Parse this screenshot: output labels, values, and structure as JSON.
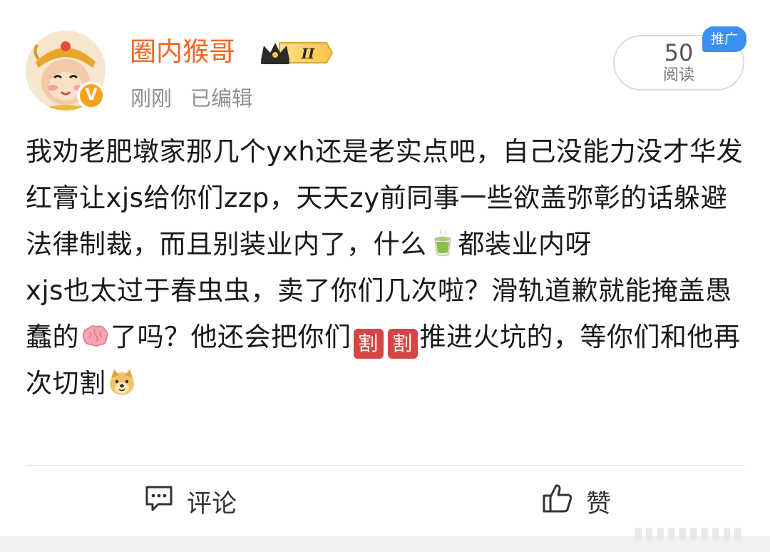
{
  "post": {
    "author": {
      "name": "圈内猴哥",
      "verified_mark": "V",
      "level_badge": "II",
      "avatar_icon": "monkey-king-avatar"
    },
    "meta": {
      "time": "刚刚",
      "edited": "已编辑"
    },
    "stats": {
      "read_count": "50",
      "read_label": "阅读",
      "ad_tag": "推广"
    },
    "body": {
      "p1_a": "我劝老肥墩家那几个yxh还是老实点吧，自己没能力没才华发红膏让xjs给你们zzp，天天zy前同事一些欲盖弥彰的话躲避法律制裁，而且别装业内了，什么",
      "p1_b": "都装业内呀",
      "p2_a": "xjs也太过于春虫虫，卖了你们几次啦？滑轨道歉就能掩盖愚蠢的",
      "p2_b": "了吗？他还会把你们",
      "cut_char": "割",
      "p2_c": "推进火坑的，等你们和他再次切割"
    }
  },
  "actions": {
    "comment_label": "评论",
    "like_label": "赞"
  },
  "colors": {
    "author_name": "#f26522",
    "ad_tag_bg": "#3b8ff0",
    "text": "#1a1a1a",
    "meta": "#8f8f8f",
    "cut_emoji_bg": "#d64545"
  },
  "icons": {
    "tea": "tea-cup-emoji",
    "brain": "brain-emoji",
    "dog": "doge-emoji",
    "comment": "comment-icon",
    "like": "thumbs-up-icon",
    "badge": "crown-badge-icon"
  }
}
